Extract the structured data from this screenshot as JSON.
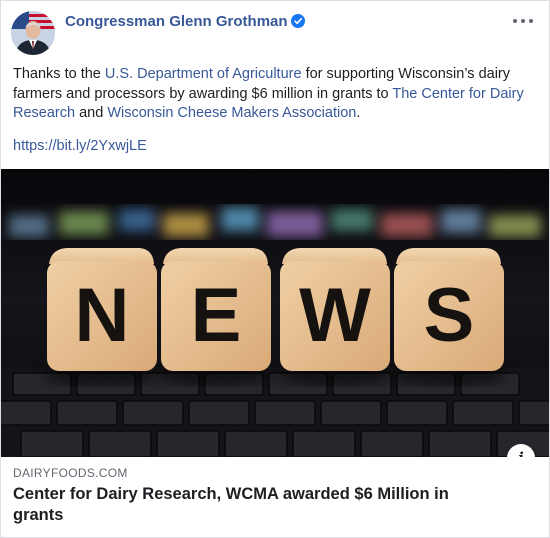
{
  "post": {
    "author": "Congressman Glenn Grothman",
    "text_parts": {
      "p1": "Thanks to the ",
      "link1": "U.S. Department of Agriculture",
      "p2": " for supporting Wisconsin’s dairy farmers and processors by awarding $6 million in grants to ",
      "link2": "The Center for Dairy Research",
      "p3": " and ",
      "link3": "Wisconsin Cheese Makers Association",
      "p4": "."
    },
    "url": "https://bit.ly/2YxwjLE"
  },
  "image": {
    "letters": [
      "N",
      "E",
      "W",
      "S"
    ]
  },
  "link_preview": {
    "domain": "DAIRYFOODS.COM",
    "headline": "Center for Dairy Research, WCMA awarded $6 Million in grants"
  },
  "icons": {
    "verified": "verified-badge-icon",
    "more": "more-options-icon",
    "info": "info-icon"
  },
  "colors": {
    "link": "#385898",
    "verified": "#1877f2"
  }
}
